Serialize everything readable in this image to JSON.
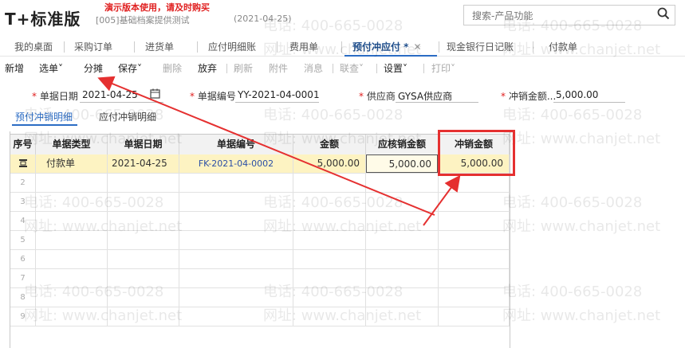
{
  "header": {
    "logo": "T+标准版",
    "demo_notice": "演示版本使用，请及时购买",
    "account": "[005]基础档案提供测试",
    "account_date": "(2021-04-25)",
    "search_placeholder": "搜索-产品功能"
  },
  "tabs": [
    {
      "label": "我的桌面"
    },
    {
      "label": "采购订单"
    },
    {
      "label": "进货单"
    },
    {
      "label": "应付明细账"
    },
    {
      "label": "费用单"
    },
    {
      "label": "预付冲应付 *",
      "active": true
    },
    {
      "label": "现金银行日记账"
    },
    {
      "label": "付款单"
    }
  ],
  "toolbar": [
    {
      "label": "新增"
    },
    {
      "label": "选单",
      "dropdown": true
    },
    {
      "label": "分摊"
    },
    {
      "label": "保存",
      "dropdown": true
    },
    {
      "label": "删除",
      "disabled": true
    },
    {
      "label": "放弃"
    },
    {
      "label": "刷新",
      "disabled": true
    },
    {
      "label": "附件",
      "disabled": true
    },
    {
      "label": "消息",
      "disabled": true
    },
    {
      "label": "联查",
      "dropdown": true,
      "disabled": true
    },
    {
      "label": "设置",
      "dropdown": true
    },
    {
      "label": "打印",
      "dropdown": true,
      "disabled": true
    }
  ],
  "form": {
    "date_label": "单据日期",
    "date_value": "2021-04-25",
    "code_label": "单据编号",
    "code_value": "YY-2021-04-0001",
    "vendor_label": "供应商",
    "vendor_value": "GYSA供应商",
    "offset_label": "冲销金额...",
    "offset_value": "5,000.00"
  },
  "subtabs": [
    {
      "label": "预付冲销明细",
      "active": true
    },
    {
      "label": "应付冲销明细"
    }
  ],
  "grid": {
    "headers": [
      "序号",
      "单据类型",
      "单据日期",
      "单据编号",
      "金额",
      "应核销金额",
      "冲销金额"
    ],
    "rows": [
      {
        "num": "",
        "type": "付款单",
        "date": "2021-04-25",
        "code": "FK-2021-04-0002",
        "amount": "5,000.00",
        "due": "5,000.00",
        "offset": "5,000.00"
      },
      {
        "num": "2"
      },
      {
        "num": "3"
      },
      {
        "num": "4"
      },
      {
        "num": "5"
      },
      {
        "num": "6"
      },
      {
        "num": "7"
      },
      {
        "num": "8"
      },
      {
        "num": "9"
      }
    ]
  },
  "watermark": {
    "phone": "电话: 400-665-0028",
    "site": "网址: www.chanjet.net"
  },
  "colors": {
    "accent": "#2b6cc4",
    "annotation": "#e53030",
    "selected_row": "#fdf3c2"
  }
}
